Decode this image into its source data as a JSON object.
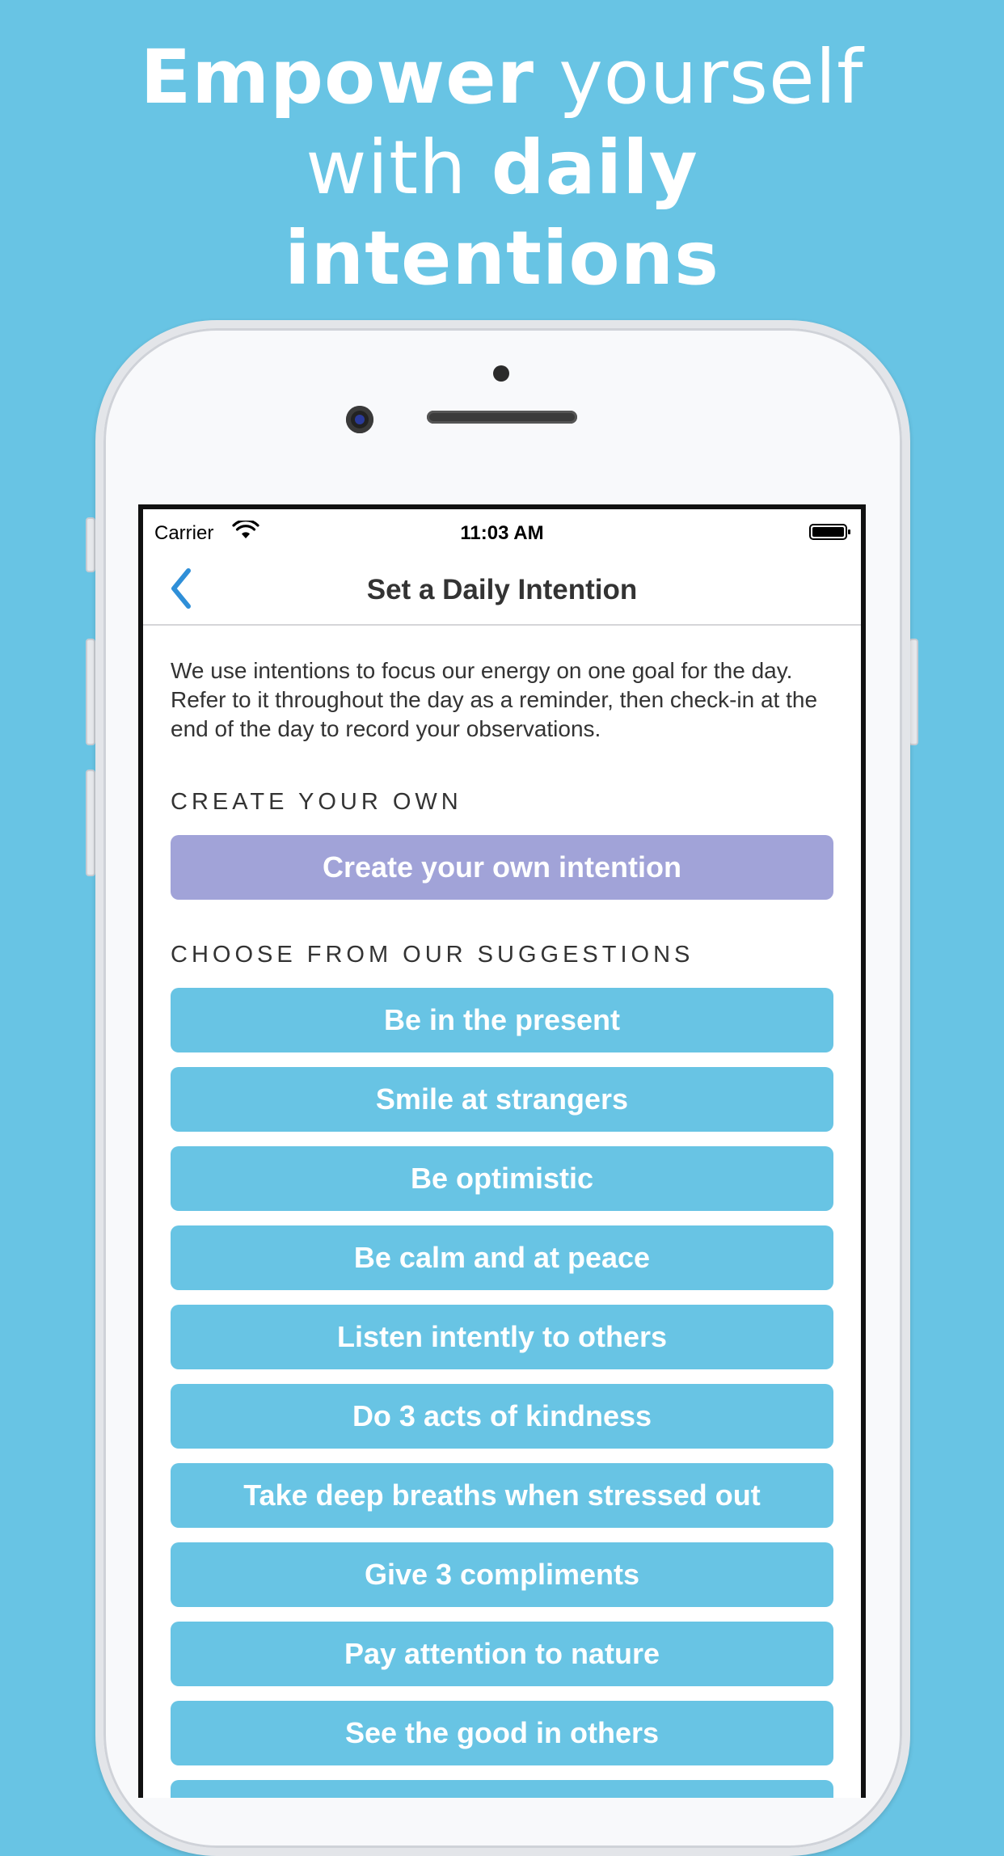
{
  "headline": {
    "line1_bold": "Empower",
    "line1_light": " yourself",
    "line2_light": "with ",
    "line2_bold": "daily",
    "line3_bold": "intentions"
  },
  "statusbar": {
    "carrier": "Carrier",
    "time": "11:03 AM",
    "icons": [
      "wifi-icon",
      "battery-icon"
    ]
  },
  "navbar": {
    "back_icon": "chevron-left-icon",
    "title": "Set a Daily Intention"
  },
  "intro": "We use intentions to focus our energy on one goal for the day. Refer to it throughout the day as a reminder, then check-in at the end of the day to record your observations.",
  "create_section": {
    "header": "CREATE YOUR OWN",
    "button": "Create your own intention"
  },
  "suggestions_section": {
    "header": "CHOOSE FROM OUR SUGGESTIONS",
    "items": [
      "Be in the present",
      "Smile at strangers",
      "Be optimistic",
      "Be calm and at peace",
      "Listen intently to others",
      "Do 3 acts of kindness",
      "Take deep breaths when stressed out",
      "Give 3 compliments",
      "Pay attention to nature",
      "See the good in others"
    ]
  },
  "colors": {
    "background": "#68c4e4",
    "suggestion_button": "#68c4e4",
    "create_button": "#a1a3d8",
    "accent_blue": "#2f8fd8",
    "text": "#333333"
  }
}
